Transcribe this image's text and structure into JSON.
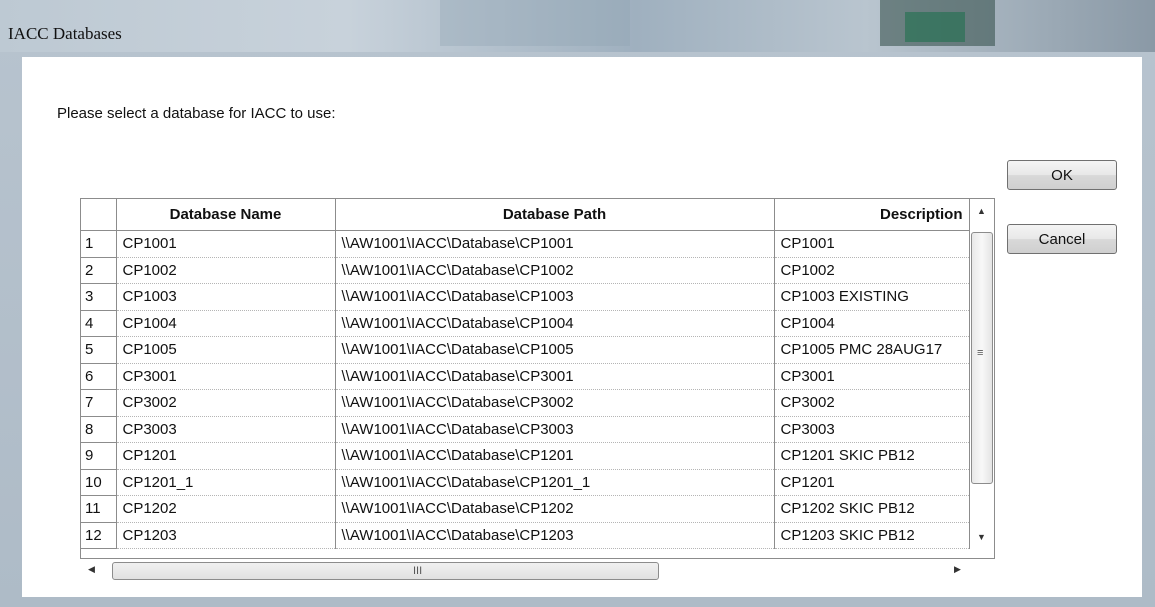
{
  "window": {
    "title": "IACC Databases"
  },
  "dialog": {
    "prompt": "Please select a database for IACC to use:",
    "ok_label": "OK",
    "cancel_label": "Cancel"
  },
  "table": {
    "columns": [
      "",
      "Database Name",
      "Database Path",
      "Description"
    ],
    "rows": [
      {
        "num": "1",
        "name": "CP1001",
        "path": "\\\\AW1001\\IACC\\Database\\CP1001",
        "desc": "CP1001"
      },
      {
        "num": "2",
        "name": "CP1002",
        "path": "\\\\AW1001\\IACC\\Database\\CP1002",
        "desc": "CP1002"
      },
      {
        "num": "3",
        "name": "CP1003",
        "path": "\\\\AW1001\\IACC\\Database\\CP1003",
        "desc": "CP1003 EXISTING"
      },
      {
        "num": "4",
        "name": "CP1004",
        "path": "\\\\AW1001\\IACC\\Database\\CP1004",
        "desc": "CP1004"
      },
      {
        "num": "5",
        "name": "CP1005",
        "path": "\\\\AW1001\\IACC\\Database\\CP1005",
        "desc": "CP1005 PMC 28AUG17"
      },
      {
        "num": "6",
        "name": "CP3001",
        "path": "\\\\AW1001\\IACC\\Database\\CP3001",
        "desc": "CP3001"
      },
      {
        "num": "7",
        "name": "CP3002",
        "path": "\\\\AW1001\\IACC\\Database\\CP3002",
        "desc": "CP3002"
      },
      {
        "num": "8",
        "name": "CP3003",
        "path": "\\\\AW1001\\IACC\\Database\\CP3003",
        "desc": "CP3003"
      },
      {
        "num": "9",
        "name": "CP1201",
        "path": "\\\\AW1001\\IACC\\Database\\CP1201",
        "desc": "CP1201 SKIC PB12"
      },
      {
        "num": "10",
        "name": "CP1201_1",
        "path": "\\\\AW1001\\IACC\\Database\\CP1201_1",
        "desc": "CP1201"
      },
      {
        "num": "11",
        "name": "CP1202",
        "path": "\\\\AW1001\\IACC\\Database\\CP1202",
        "desc": "CP1202 SKIC PB12"
      },
      {
        "num": "12",
        "name": "CP1203",
        "path": "\\\\AW1001\\IACC\\Database\\CP1203",
        "desc": "CP1203 SKIC PB12"
      }
    ]
  },
  "scrollbars": {
    "up_glyph": "▲",
    "down_glyph": "▼",
    "left_glyph": "◀",
    "right_glyph": "▶",
    "v_grip": "≡",
    "h_grip": "III"
  }
}
